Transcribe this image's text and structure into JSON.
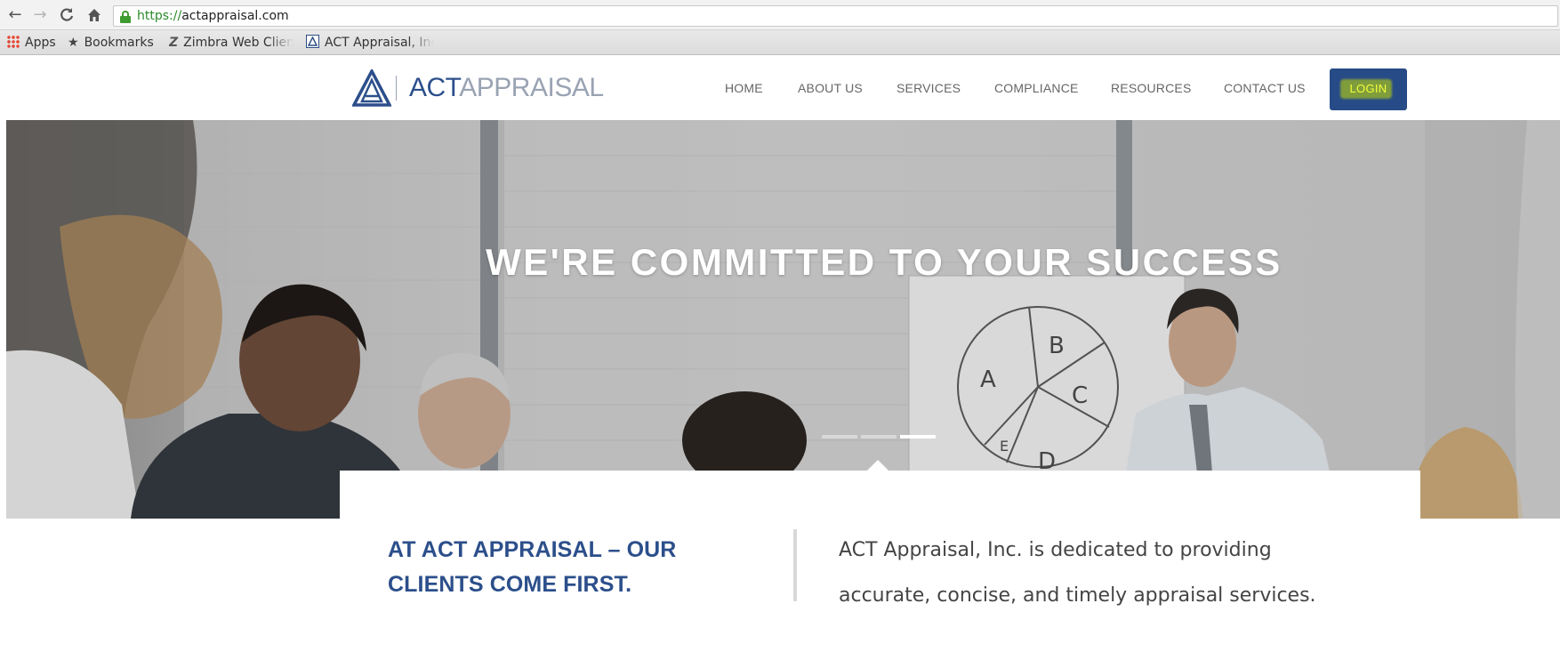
{
  "browser": {
    "nav": {
      "back": "←",
      "forward": "→",
      "reload": "C",
      "home": "⌂"
    },
    "url": {
      "scheme": "https://",
      "host": "actappraisal.com"
    },
    "bookmarks": {
      "apps": "Apps",
      "bookmarks": "Bookmarks",
      "zimbra": "Zimbra Web Clien",
      "act": "ACT Appraisal, Inc"
    }
  },
  "site": {
    "logo": {
      "act": "ACT",
      "appraisal": "APPRAISAL"
    },
    "nav": [
      "HOME",
      "ABOUT US",
      "SERVICES",
      "COMPLIANCE",
      "RESOURCES",
      "CONTACT US"
    ],
    "login": "LOGIN",
    "colors": {
      "brand_blue": "#2c4f8b",
      "login_bg": "#274b86",
      "login_text": "#f4ff3a"
    }
  },
  "hero": {
    "title": "WE'RE COMMITTED TO YOUR SUCCESS",
    "slides": {
      "total": 3,
      "active": 3
    },
    "whiteboard_labels": [
      "A",
      "B",
      "C",
      "D",
      "E"
    ]
  },
  "intro": {
    "heading_line1": "AT ACT APPRAISAL – OUR",
    "heading_line2": "CLIENTS COME FIRST.",
    "text_line1": "ACT Appraisal, Inc. is dedicated to providing",
    "text_line2": "accurate, concise, and timely appraisal services."
  }
}
